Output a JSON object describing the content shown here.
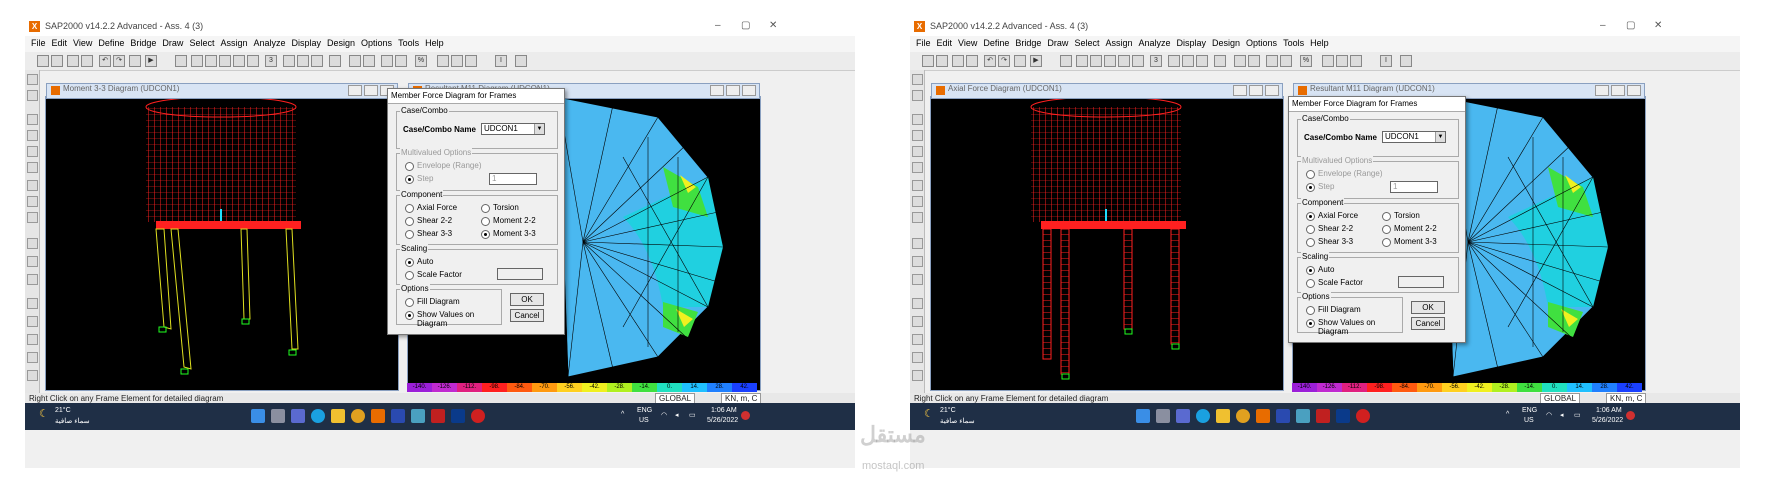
{
  "screens": [
    {
      "window_title": "SAP2000 v14.2.2 Advanced - Ass. 4 (3)",
      "menu": [
        "File",
        "Edit",
        "View",
        "Define",
        "Bridge",
        "Draw",
        "Select",
        "Assign",
        "Analyze",
        "Display",
        "Design",
        "Options",
        "Tools",
        "Help"
      ],
      "left_panel_title": "Moment 3-3 Diagram   (UDCON1)",
      "right_panel_title": "Resultant M11 Diagram   (UDCON1)",
      "dialog": {
        "title": "Member Force Diagram for Frames",
        "case_group": "Case/Combo",
        "case_label": "Case/Combo Name",
        "case_value": "UDCON1",
        "multivalued_group": "Multivalued Options",
        "envelope_label": "Envelope (Range)",
        "step_label": "Step",
        "step_value": "1",
        "component_group": "Component",
        "axial_label": "Axial Force",
        "torsion_label": "Torsion",
        "shear22_label": "Shear 2-2",
        "moment22_label": "Moment 2-2",
        "shear33_label": "Shear 3-3",
        "moment33_label": "Moment 3-3",
        "selected_component": "Moment 3-3",
        "scaling_group": "Scaling",
        "auto_label": "Auto",
        "scale_factor_label": "Scale Factor",
        "options_group": "Options",
        "fill_label": "Fill Diagram",
        "show_values_label": "Show Values on Diagram",
        "ok_label": "OK",
        "cancel_label": "Cancel"
      },
      "status_text": "Right Click on any Frame Element for detailed diagram",
      "coord_system": "GLOBAL",
      "units": "KN, m, C"
    },
    {
      "window_title": "SAP2000 v14.2.2 Advanced - Ass. 4 (3)",
      "menu": [
        "File",
        "Edit",
        "View",
        "Define",
        "Bridge",
        "Draw",
        "Select",
        "Assign",
        "Analyze",
        "Display",
        "Design",
        "Options",
        "Tools",
        "Help"
      ],
      "left_panel_title": "Axial Force Diagram   (UDCON1)",
      "right_panel_title": "Resultant M11 Diagram   (UDCON1)",
      "dialog": {
        "title": "Member Force Diagram for Frames",
        "case_group": "Case/Combo",
        "case_label": "Case/Combo Name",
        "case_value": "UDCON1",
        "multivalued_group": "Multivalued Options",
        "envelope_label": "Envelope (Range)",
        "step_label": "Step",
        "step_value": "1",
        "component_group": "Component",
        "axial_label": "Axial Force",
        "torsion_label": "Torsion",
        "shear22_label": "Shear 2-2",
        "moment22_label": "Moment 2-2",
        "shear33_label": "Shear 3-3",
        "moment33_label": "Moment 3-3",
        "selected_component": "Axial Force",
        "scaling_group": "Scaling",
        "auto_label": "Auto",
        "scale_factor_label": "Scale Factor",
        "options_group": "Options",
        "fill_label": "Fill Diagram",
        "show_values_label": "Show Values on Diagram",
        "ok_label": "OK",
        "cancel_label": "Cancel"
      },
      "status_text": "Right Click on any Frame Element for detailed diagram",
      "coord_system": "GLOBAL",
      "units": "KN, m, C"
    }
  ],
  "colorbar_labels": [
    "-140.",
    "-126.",
    "-112.",
    "-98.",
    "-84.",
    "-70.",
    "-56.",
    "-42.",
    "-28.",
    "-14.",
    "0.",
    "14.",
    "28.",
    "42."
  ],
  "colorbar_colors": [
    "#9b1fd8",
    "#c02ad0",
    "#e02080",
    "#ff2020",
    "#ff5a10",
    "#ff9a10",
    "#ffd020",
    "#f0f020",
    "#b0f020",
    "#40e040",
    "#20e0c0",
    "#20c0ff",
    "#2080ff",
    "#1a40ff"
  ],
  "taskbar": {
    "weather_temp": "21°C",
    "weather_desc": "سماء صافية",
    "lang": "ENG",
    "region": "US",
    "time": "1:06 AM",
    "date": "5/26/2022"
  },
  "watermark": "مستقل",
  "watermark_url": "mostaql.com"
}
